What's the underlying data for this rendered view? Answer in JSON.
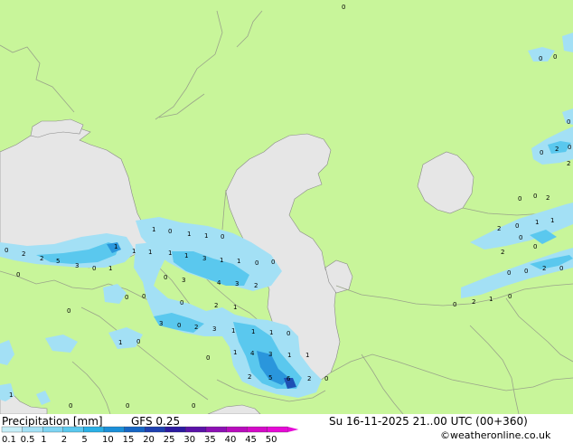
{
  "colors": {
    "land": "#c8f59a",
    "sea": "#e6e6e6",
    "border": "#9aa48a",
    "precip_light": "#a3e0f5",
    "precip_mid": "#5ac8ee",
    "precip_strong": "#2a96dc",
    "precip_heavy": "#1e50b4"
  },
  "footer": {
    "title": "Precipitation [mm]",
    "model": "GFS 0.25",
    "valid_time": "Su 16-11-2025 21..00 UTC (00+360)",
    "credit": "©weatheronline.co.uk"
  },
  "scale": {
    "labels": [
      "0.1",
      "0.5",
      "1",
      "2",
      "5",
      "10",
      "15",
      "20",
      "25",
      "30",
      "35",
      "40",
      "45",
      "50"
    ],
    "colors": [
      "#c6eef8",
      "#a3e0f5",
      "#7ed4f2",
      "#5ac8ee",
      "#2ab0e6",
      "#1b8fd8",
      "#1666c4",
      "#1d40b0",
      "#2c1aa0",
      "#5a12a8",
      "#8c10b4",
      "#b80cbc",
      "#d40ac8",
      "#e60ad6"
    ]
  },
  "map_values": [
    {
      "v": "0"
    },
    {
      "v": "0"
    },
    {
      "v": "0"
    },
    {
      "v": "0"
    },
    {
      "v": "0"
    },
    {
      "v": "2"
    },
    {
      "v": "0"
    },
    {
      "v": "2"
    },
    {
      "v": "0"
    },
    {
      "v": "2"
    },
    {
      "v": "2"
    },
    {
      "v": "5"
    },
    {
      "v": "3"
    },
    {
      "v": "0"
    },
    {
      "v": "1"
    },
    {
      "v": "1"
    },
    {
      "v": "1"
    },
    {
      "v": "1"
    },
    {
      "v": "1"
    },
    {
      "v": "0"
    },
    {
      "v": "1"
    },
    {
      "v": "1"
    },
    {
      "v": "0"
    },
    {
      "v": "1"
    },
    {
      "v": "1"
    },
    {
      "v": "3"
    },
    {
      "v": "1"
    },
    {
      "v": "1"
    },
    {
      "v": "0"
    },
    {
      "v": "0"
    },
    {
      "v": "0"
    },
    {
      "v": "3"
    },
    {
      "v": "4"
    },
    {
      "v": "3"
    },
    {
      "v": "2"
    },
    {
      "v": "0"
    },
    {
      "v": "0"
    },
    {
      "v": "0"
    },
    {
      "v": "2"
    },
    {
      "v": "1"
    },
    {
      "v": "3"
    },
    {
      "v": "0"
    },
    {
      "v": "2"
    },
    {
      "v": "3"
    },
    {
      "v": "1"
    },
    {
      "v": "1"
    },
    {
      "v": "1"
    },
    {
      "v": "0"
    },
    {
      "v": "1"
    },
    {
      "v": "0"
    },
    {
      "v": "1"
    },
    {
      "v": "4"
    },
    {
      "v": "3"
    },
    {
      "v": "1"
    },
    {
      "v": "1"
    },
    {
      "v": "2"
    },
    {
      "v": "5"
    },
    {
      "v": "6"
    },
    {
      "v": "2"
    },
    {
      "v": "0"
    },
    {
      "v": "1"
    },
    {
      "v": "0"
    },
    {
      "v": "0"
    },
    {
      "v": "0"
    },
    {
      "v": "0"
    },
    {
      "v": "0"
    },
    {
      "v": "2"
    },
    {
      "v": "2"
    },
    {
      "v": "0"
    },
    {
      "v": "1"
    },
    {
      "v": "1"
    },
    {
      "v": "0"
    },
    {
      "v": "0"
    },
    {
      "v": "2"
    },
    {
      "v": "0"
    },
    {
      "v": "0"
    },
    {
      "v": "2"
    },
    {
      "v": "0"
    },
    {
      "v": "2"
    },
    {
      "v": "1"
    },
    {
      "v": "0"
    },
    {
      "v": "0"
    },
    {
      "v": "0"
    },
    {
      "v": "0"
    },
    {
      "v": "0"
    }
  ]
}
